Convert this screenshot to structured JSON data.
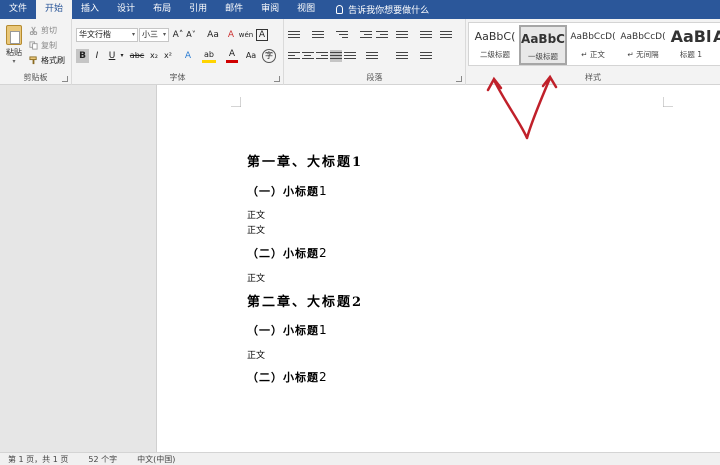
{
  "tabs": [
    "文件",
    "开始",
    "插入",
    "设计",
    "布局",
    "引用",
    "邮件",
    "审阅",
    "视图"
  ],
  "active_tab": "开始",
  "tell_me": "告诉我你想要做什么",
  "clipboard": {
    "paste": "粘贴",
    "cut": "剪切",
    "copy": "复制",
    "format_painter": "格式刷",
    "group_label": "剪贴板"
  },
  "font": {
    "font_name": "华文行楷",
    "font_size": "小三",
    "grow": "A˄",
    "shrink": "A˅",
    "change_case": "Aa",
    "clear": "A",
    "wen": "wén",
    "boxed": "A",
    "bold": "B",
    "italic": "I",
    "underline": "U",
    "strike": "abc",
    "subscript": "x₂",
    "superscript": "x²",
    "effects": "A",
    "highlight": "ab",
    "font_color": "A",
    "aa": "Aa",
    "circle": "字",
    "group_label": "字体"
  },
  "paragraph": {
    "group_label": "段落"
  },
  "styles": {
    "items": [
      {
        "preview": "AaBbC(",
        "name": "二级标题"
      },
      {
        "preview": "AaBbC",
        "name": "一级标题"
      },
      {
        "preview": "AaBbCcD(",
        "name": "↵ 正文"
      },
      {
        "preview": "AaBbCcD(",
        "name": "↵ 无间隔"
      },
      {
        "preview": "AaBl",
        "name": "标题 1"
      },
      {
        "preview": "A",
        "name": ""
      }
    ],
    "group_label": "样式"
  },
  "colors": {
    "tab_bar": "#2b579a",
    "arrow": "#c0202a",
    "highlight": "#ffd400",
    "font_color": "#d00000"
  },
  "document": {
    "lines": [
      {
        "kind": "h1",
        "text": "第一章、大标题",
        "num": "1"
      },
      {
        "kind": "h2",
        "text": "（一）小标题",
        "num": "1"
      },
      {
        "kind": "body",
        "text": "正文"
      },
      {
        "kind": "body",
        "text": "正文"
      },
      {
        "kind": "h2",
        "text": "（二）小标题",
        "num": "2"
      },
      {
        "kind": "body",
        "text": "正文"
      },
      {
        "kind": "h1",
        "text": "第二章、大标题",
        "num": "2"
      },
      {
        "kind": "h2",
        "text": "（一）小标题",
        "num": "1"
      },
      {
        "kind": "body",
        "text": "正文"
      },
      {
        "kind": "h2",
        "text": "（二）小标题",
        "num": "2"
      }
    ]
  },
  "status": {
    "page": "第 1 页，共 1 页",
    "words": "52 个字",
    "language": "中文(中国)"
  }
}
